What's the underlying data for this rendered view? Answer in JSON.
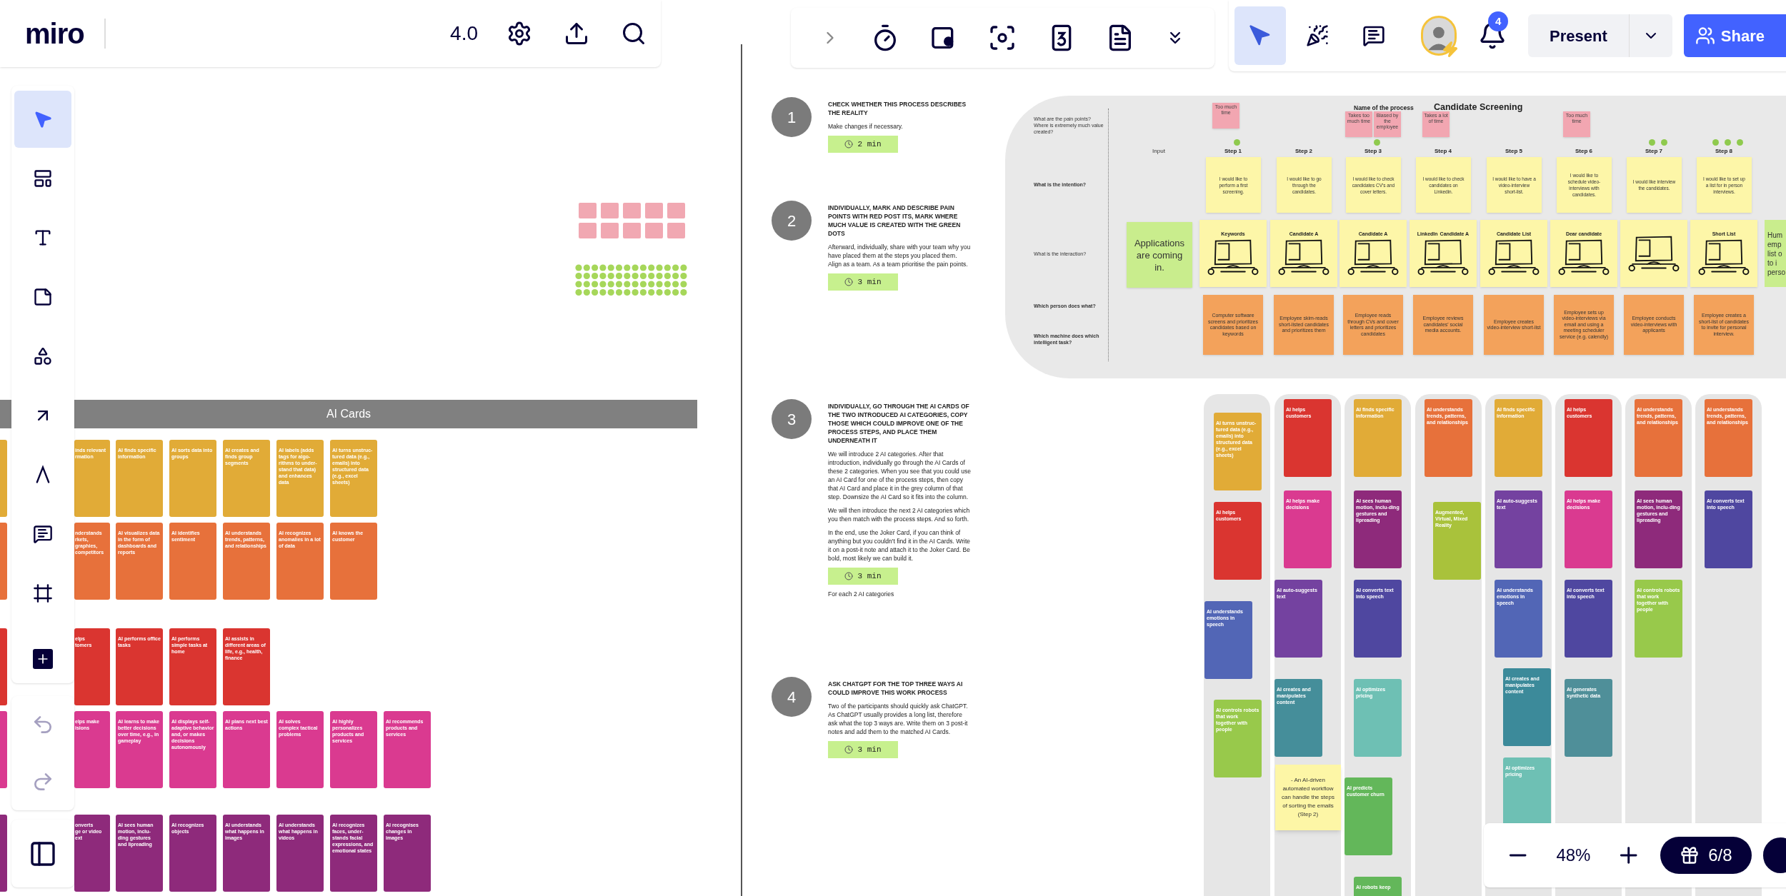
{
  "top_left_bar": {
    "logo": "miro",
    "version": "4.0"
  },
  "tools": [
    {
      "kind": "select",
      "selected": true
    },
    {
      "kind": "templates",
      "selected": false
    },
    {
      "kind": "text",
      "selected": false
    },
    {
      "kind": "sticky_note",
      "selected": false
    },
    {
      "kind": "shapes",
      "selected": false
    },
    {
      "kind": "connector",
      "selected": false
    },
    {
      "kind": "pen",
      "selected": false
    },
    {
      "kind": "comment",
      "selected": false
    },
    {
      "kind": "frame",
      "selected": false
    },
    {
      "kind": "more",
      "selected": false
    }
  ],
  "history": [
    {
      "kind": "undo",
      "disabled": true
    },
    {
      "kind": "redo",
      "disabled": true
    }
  ],
  "top_right": {
    "items": [
      {
        "kind": "cursor",
        "selected": true
      },
      {
        "kind": "reactions",
        "selected": false
      },
      {
        "kind": "comments",
        "selected": false
      }
    ],
    "notifications": "4",
    "present": "Present",
    "share": "Share"
  },
  "ai_cards": {
    "title": "AI Cards",
    "rows": [
      {
        "color": "#e1ab37",
        "cards": [
          "inds relevant\nrmation",
          "AI finds specific information",
          "AI sorts data into groups",
          "AI creates and finds group segments",
          "AI labels (adds tags for algo-rithms to under-stand that data) and enhances data",
          "AI turns unstruc-tured data (e.g., emails) into structured data (e.g., excel sheets)"
        ]
      },
      {
        "color": "#e7713b",
        "cards": [
          "nderstands\nrkets,\ngraphies,\ncompetitors",
          "AI visualizes data in the form of dashboards and reports",
          "AI identifies sentiment",
          "AI understands trends, patterns, and relationships",
          "AI recognizes anomalies in a lot of data",
          "AI knows the customer"
        ]
      },
      {
        "color": "#da3530",
        "cards": [
          "elps\ntomers",
          "AI performs office tasks",
          "AI performs simple tasks at home",
          "AI assists in different areas of life, e.g., health, finance"
        ]
      },
      {
        "color": "#da3a90",
        "cards": [
          "elps make\nisions",
          "AI learns to make better decisions over time, e.g., in gameplay",
          "AI displays self-adaptive behavior and, or makes decisions autonomously",
          "AI plans next best actions",
          "AI solves complex tactical problems",
          "AI highly personalizes products and services",
          "AI recommends products and services"
        ]
      },
      {
        "color": "#8e2a7b",
        "cards": [
          "onverts\nge or video\next",
          "AI sees human motion, inclu-ding gestures and lipreading",
          "AI recognizes objects",
          "AI understands what happens in images",
          "AI understands what happens in videos",
          "AI recognizes faces, under-stands facial expressions, and emotional states",
          "AI recognises changes in images"
        ]
      }
    ]
  },
  "exercise": [
    {
      "number": "1",
      "heading": "CHECK WHETHER THIS PROCESS DESCRIBES THE REALITY",
      "paragraphs": [
        "Make changes if necessary."
      ],
      "timer": "2 min"
    },
    {
      "number": "2",
      "heading": "INDIVIDUALLY, MARK AND DESCRIBE PAIN POINTS WITH RED POST ITS, MARK WHERE MUCH VALUE IS CREATED WITH THE GREEN DOTS",
      "paragraphs": [
        "Afterward, individually, share with your team why you have placed them at the steps you placed them. Align as a team. As a team prioritise the pain points."
      ],
      "timer": "3 min"
    },
    {
      "number": "3",
      "heading": "INDIVIDUALLY, GO THROUGH THE AI CARDS OF THE TWO INTRODUCED AI CATEGORIES, COPY THOSE WHICH COULD IMPROVE ONE OF THE PROCESS STEPS, AND PLACE THEM UNDERNEATH IT",
      "paragraphs": [
        "We will introduce 2 AI categories. After that introduction, individually go through the AI Cards of these 2 categories. When you see that you could use an AI Card for one of the process steps, then copy that AI Card and place it in the grey column of that step. Downsize the AI Card so it fits into the column.",
        "We will then introduce the next 2 AI categories which you then match with the process steps. And so forth.",
        "In the end, use the Joker Card, if you can think of anything but you couldn't find it in the AI Cards. Write it on a post-it note and attach it to the Joker Card. Be bold, most likely we can build it."
      ],
      "timer": "3 min",
      "note": "For each 2 AI categories"
    },
    {
      "number": "4",
      "heading": "ASK CHATGPT FOR THE TOP THREE WAYS AI COULD IMPROVE THIS WORK PROCESS",
      "paragraphs": [
        "Two of the participants should quickly ask ChatGPT. As ChatGPT usually provides a long list, therefore ask what the top 3 ways are. Write them on 3 post-it notes and add them to the matched AI Cards."
      ],
      "timer": "3 min"
    }
  ],
  "process": {
    "name_label": "Name of the process",
    "title": "Candidate Screening",
    "row_labels": [
      "What are the pain points? Where is extremely much value created?",
      "What is the intention?",
      "What is the interaction?",
      "Which person does what?",
      "Which machine does which intelligent task?"
    ],
    "input_label": "Input",
    "input_note": "Applications are coming in.",
    "cut_note": "Hum\nemp\nlist o\nto i\nperso",
    "steps": [
      {
        "label": "Step 1",
        "pain_points": [
          "Too much time"
        ],
        "value_dots": [
          {
            "kind": "green_dot"
          }
        ],
        "intention": "I would like to perform a first screening.",
        "sketch_labels": [
          "Keywords"
        ],
        "task": "Computer software screens and prioritizes candidates based on keywords"
      },
      {
        "label": "Step 2",
        "intention": "I would like to go through the candidates.",
        "sketch_labels": [
          "Candidate A"
        ],
        "task": "Employee skim-reads short-listed candidates and prioritizes them"
      },
      {
        "label": "Step 3",
        "pain_points": [
          "Takes too much time",
          "Biased by the employee"
        ],
        "value_dots": [
          {
            "kind": "green_dot"
          }
        ],
        "intention": "I would like to check candidates CV's and cover letters.",
        "sketch_labels": [
          "Candidate A"
        ],
        "task": "Employee reads through CVs and cover letters and prioritizes candidates"
      },
      {
        "label": "Step 4",
        "pain_points": [
          "Takes a lot of time"
        ],
        "intention": "I would like to check candidates on Linkedin.",
        "sketch_labels": [
          "LinkedIn",
          "Candidate A"
        ],
        "task": "Employee reviews candidates' social media accounts."
      },
      {
        "label": "Step 5",
        "intention": "I would like to have a video-interview short-list.",
        "sketch_labels": [
          "Candidate List"
        ],
        "task": "Employee creates video-interview short-list"
      },
      {
        "label": "Step 6",
        "pain_points": [
          "Too much time"
        ],
        "intention": "I would like to schedule video-interviews with candidates.",
        "sketch_labels": [
          "Dear candidate"
        ],
        "task": "Employee sets up video-interviews via email and using a meeting scheduler service (e.g. calendly)"
      },
      {
        "label": "Step 7",
        "value_dots": [
          {
            "kind": "green_dot"
          },
          {
            "kind": "green_dot"
          }
        ],
        "intention": "I would like interview the candidates.",
        "task": "Employee conducts video-interviews with applicants"
      },
      {
        "label": "Step 8",
        "value_dots": [
          {
            "kind": "green_dot"
          },
          {
            "kind": "green_dot"
          },
          {
            "kind": "green_dot"
          }
        ],
        "intention": "I would like to set up a list for in person interviews.",
        "sketch_labels": [
          "Short List"
        ],
        "task": "Employee creates a short-list of candidates to invite for personal interview."
      }
    ]
  },
  "step_columns": [
    {
      "cards": [
        {
          "kind": "ai_card",
          "color": "#e1ab37",
          "text": "AI turns unstruc-tured data (e.g., emails) into structured data (e.g., excel sheets)"
        },
        {
          "kind": "ai_card",
          "color": "#da3530",
          "text": "AI helps customers"
        },
        {
          "kind": "ai_card",
          "color": "#5266b6",
          "text": "AI understands emotions in speech"
        },
        {
          "kind": "ai_card",
          "color": "#98c94b",
          "text": "AI controls robots that work together with people"
        }
      ]
    },
    {
      "cards": [
        {
          "kind": "ai_card",
          "color": "#da3530",
          "text": "AI helps customers"
        },
        {
          "kind": "ai_card",
          "color": "#da3a90",
          "text": "AI helps make decisions"
        },
        {
          "kind": "ai_card",
          "color": "#7442a0",
          "text": "AI auto-suggests text"
        },
        {
          "kind": "ai_card",
          "color": "#458e9a",
          "text": "AI creates and manipulates content"
        },
        {
          "kind": "sticky",
          "color": "#fdf6a6",
          "text": "- An AI-driven automated workflow can handle the steps of sorting the emails (Step 2)"
        }
      ]
    },
    {
      "cards": [
        {
          "kind": "ai_card",
          "color": "#e1ab37",
          "text": "AI finds specific information"
        },
        {
          "kind": "ai_card",
          "color": "#8e2a7b",
          "text": "AI sees human motion, inclu-ding gestures and lipreading"
        },
        {
          "kind": "ai_card",
          "color": "#4f47a0",
          "text": "AI converts text into speech"
        },
        {
          "kind": "ai_card",
          "color": "#6ec0b4",
          "text": "AI optimizes pricing"
        },
        {
          "kind": "ai_card",
          "color": "#63b75a",
          "text": "AI predicts customer churn"
        },
        {
          "kind": "ai_card",
          "color": "#63b75a",
          "text": "AI robots keep"
        }
      ]
    },
    {
      "cards": [
        {
          "kind": "ai_card",
          "color": "#e7713b",
          "text": "AI understands trends, patterns, and relationships"
        },
        {
          "kind": "ai_card",
          "color": "#a9c23b",
          "text": "Augmented, Virtual, Mixed Reality"
        }
      ]
    },
    {
      "cards": [
        {
          "kind": "ai_card",
          "color": "#e1ab37",
          "text": "AI finds specific information"
        },
        {
          "kind": "ai_card",
          "color": "#7442a0",
          "text": "AI auto-suggests text"
        },
        {
          "kind": "ai_card",
          "color": "#5266b6",
          "text": "AI understands emotions in speech"
        },
        {
          "kind": "ai_card",
          "color": "#3c8a9a",
          "text": "AI creates and manipulates content"
        },
        {
          "kind": "ai_card",
          "color": "#6ec0b4",
          "text": "AI optimizes pricing"
        }
      ]
    },
    {
      "cards": [
        {
          "kind": "ai_card",
          "color": "#da3530",
          "text": "AI helps customers"
        },
        {
          "kind": "ai_card",
          "color": "#da3a90",
          "text": "AI helps make decisions"
        },
        {
          "kind": "ai_card",
          "color": "#4f47a0",
          "text": "AI converts text into speech"
        },
        {
          "kind": "ai_card",
          "color": "#4f8f99",
          "text": "AI generates synthetic data"
        }
      ]
    },
    {
      "cards": [
        {
          "kind": "ai_card",
          "color": "#e7713b",
          "text": "AI understands trends, patterns, and relationships"
        },
        {
          "kind": "ai_card",
          "color": "#8e2a7b",
          "text": "AI sees human motion, inclu-ding gestures and lipreading"
        },
        {
          "kind": "ai_card",
          "color": "#98c94b",
          "text": "AI controls robots that work together with people"
        }
      ]
    },
    {
      "cards": [
        {
          "kind": "ai_card",
          "color": "#e7713b",
          "text": "AI understands trends, patterns, and relationships"
        },
        {
          "kind": "ai_card",
          "color": "#4f47a0",
          "text": "AI converts text into speech"
        }
      ]
    }
  ],
  "zoom_controls": {
    "zoom": "48%",
    "progress": "6/8"
  }
}
